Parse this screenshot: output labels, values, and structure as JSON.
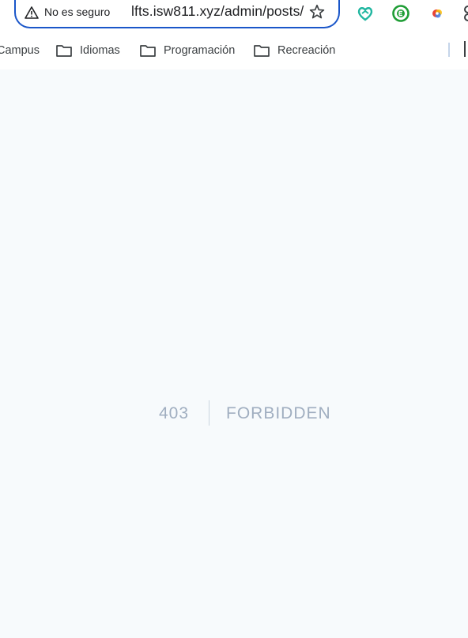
{
  "address_bar": {
    "security_label": "No es seguro",
    "url": "lfts.isw811.xyz/admin/posts/"
  },
  "bookmarks": [
    {
      "label": "Campus"
    },
    {
      "label": "Idiomas"
    },
    {
      "label": "Programación"
    },
    {
      "label": "Recreación"
    }
  ],
  "error": {
    "code": "403",
    "message": "FORBIDDEN"
  },
  "colors": {
    "page_bg": "#f7fafc",
    "error_text": "#a0aec0",
    "omnibox_focus": "#1a56c9"
  }
}
